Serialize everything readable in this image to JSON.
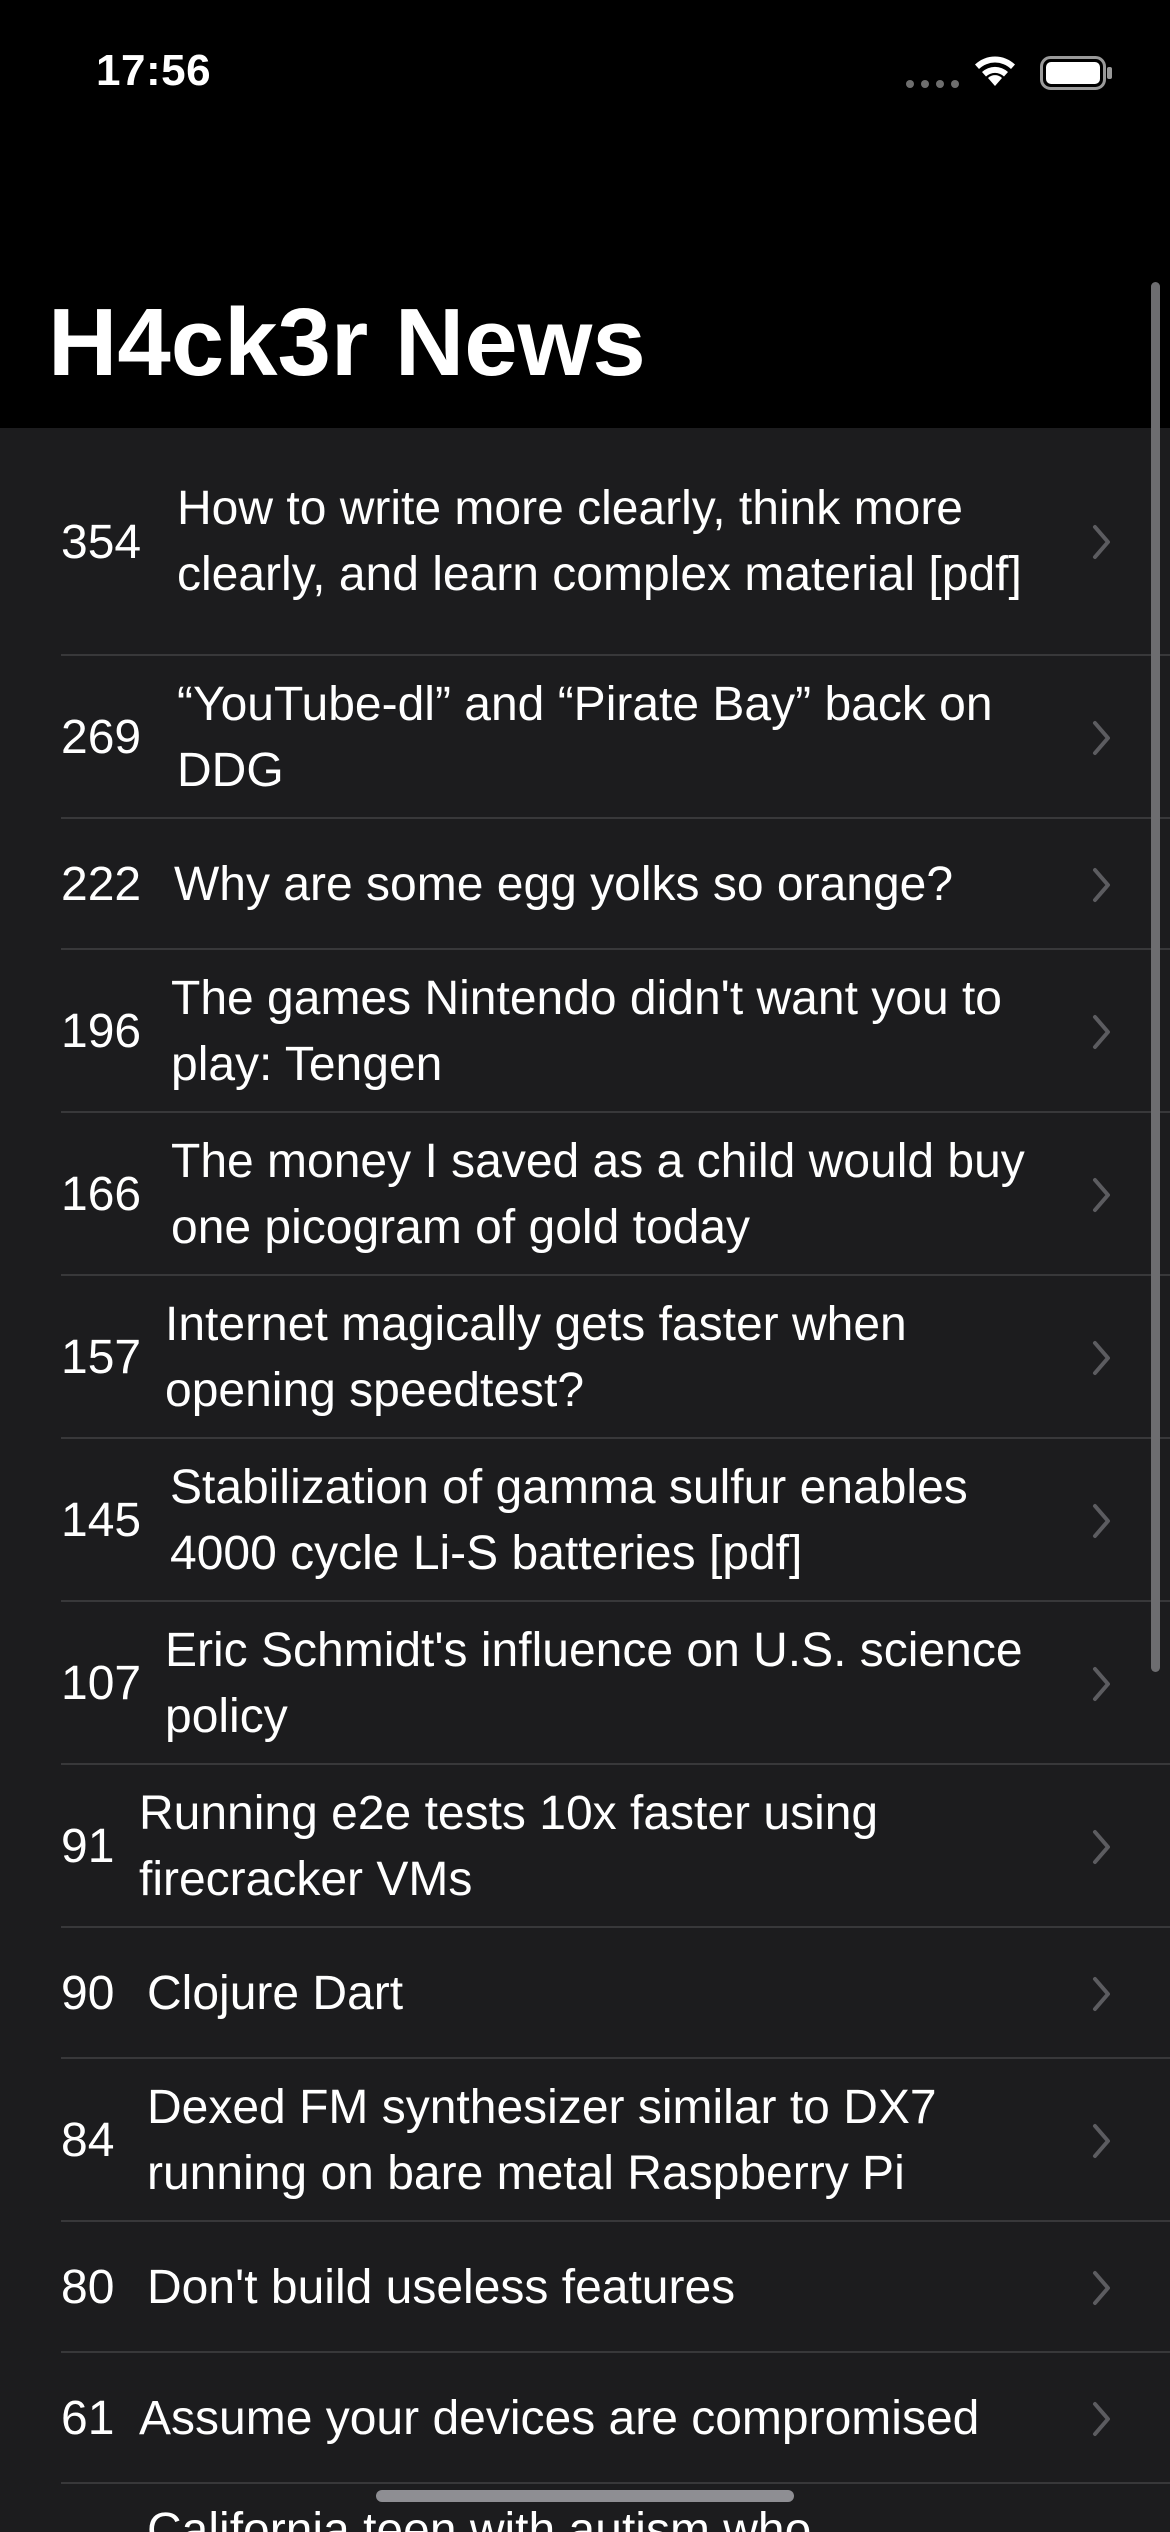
{
  "status_bar": {
    "time": "17:56"
  },
  "title": "H4ck3r News",
  "stories": [
    {
      "points": "354",
      "headline": "How to write more clearly, think more clearly, and learn complex material [pdf]"
    },
    {
      "points": "269",
      "headline": "“YouTube-dl” and “Pirate Bay” back on DDG"
    },
    {
      "points": "222",
      "headline": "Why are some egg yolks so orange?"
    },
    {
      "points": "196",
      "headline": "The games Nintendo didn't want you to play: Tengen"
    },
    {
      "points": "166",
      "headline": "The money I saved as a child would buy one picogram of gold today"
    },
    {
      "points": "157",
      "headline": "Internet magically gets faster when opening speedtest?"
    },
    {
      "points": "145",
      "headline": "Stabilization of gamma sulfur enables 4000 cycle Li-S batteries [pdf]"
    },
    {
      "points": "107",
      "headline": "Eric Schmidt's influence on U.S. science policy"
    },
    {
      "points": "91",
      "headline": "Running e2e tests 10x faster using firecracker VMs"
    },
    {
      "points": "90",
      "headline": "Clojure Dart"
    },
    {
      "points": "84",
      "headline": "Dexed FM synthesizer similar to DX7 running on bare metal Raspberry Pi"
    },
    {
      "points": "80",
      "headline": "Don't build useless features"
    },
    {
      "points": "61",
      "headline": "Assume your devices are compromised"
    },
    {
      "points": "",
      "headline": "California teen with autism who"
    }
  ],
  "icons": {
    "row_accessory": "chevron-right-icon",
    "wifi": "wifi-icon",
    "battery": "battery-icon",
    "signal": "cellular-signal-icon"
  }
}
